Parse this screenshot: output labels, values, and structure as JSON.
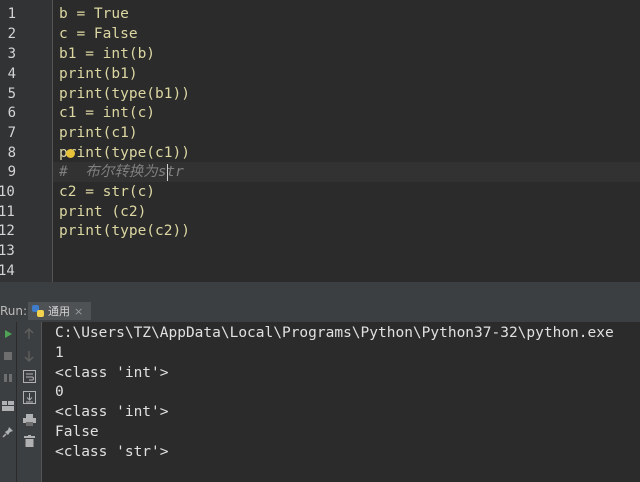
{
  "editor": {
    "line_numbers": [
      "1",
      "2",
      "3",
      "4",
      "5",
      "6",
      "7",
      "8",
      "9",
      "10",
      "11",
      "12",
      "13",
      "14"
    ],
    "lines": [
      "b = True",
      "c = False",
      "b1 = int(b)",
      "print(b1)",
      "print(type(b1))",
      "c1 = int(c)",
      "print(c1)",
      "print(type(c1))",
      "#  布尔转换为str",
      "c2 = str(c)",
      "print (c2)",
      "print(type(c2))",
      "",
      ""
    ],
    "current_line": 9
  },
  "run_panel": {
    "label": "Run:",
    "tab_label": "通用",
    "tab_close": "×"
  },
  "console": {
    "lines": [
      "C:\\Users\\TZ\\AppData\\Local\\Programs\\Python\\Python37-32\\python.exe",
      "1",
      "<class 'int'>",
      "0",
      "<class 'int'>",
      "False",
      "<class 'str'>"
    ]
  },
  "colors": {
    "editor_bg": "#2b2b2b",
    "gutter_bg": "#313335",
    "code_text": "#dcd7a2",
    "comment_text": "#7f7f7f",
    "console_text": "#e0e0e0",
    "run_green": "#4fa356"
  },
  "icons": {
    "toolbar_left": [
      "rerun-icon",
      "stop-icon",
      "pause-icon",
      "layout-icon",
      "pin-icon"
    ],
    "toolbar_mid": [
      "scroll-up-icon",
      "scroll-down-icon",
      "soft-wrap-icon",
      "scroll-to-end-icon",
      "print-icon",
      "trash-icon"
    ]
  }
}
